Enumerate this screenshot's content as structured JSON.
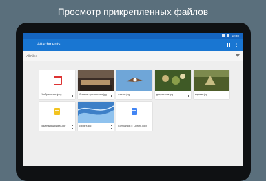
{
  "headline": "Просмотр прикрепленных файлов",
  "statusbar": {
    "time": "12:30"
  },
  "appbar": {
    "back": "←",
    "title": "Attachments"
  },
  "filterbar": {
    "label": "All Files"
  },
  "colors": {
    "appbar": "#1976d2",
    "statusbar": "#1565c0",
    "background": "#5a6f7c"
  },
  "files": [
    {
      "name": "Изображение.jpeg",
      "size": "",
      "thumb": "calendar-icon"
    },
    {
      "name": "Снимок приложения.jpg",
      "size": "",
      "thumb": "photo-stage"
    },
    {
      "name": "знание.jpg",
      "size": "",
      "thumb": "photo-bird"
    },
    {
      "name": "документы.jpg",
      "size": "",
      "thumb": "photo-flowers"
    },
    {
      "name": "каравы.jpg",
      "size": "",
      "thumb": "photo-fields"
    },
    {
      "name": "Лицензия шрифта.pdf",
      "size": "",
      "thumb": "pdf-icon"
    },
    {
      "name": "скрипт.doc",
      "size": "",
      "thumb": "blue-wave"
    },
    {
      "name": "Сompanion 5_Oxford.docx",
      "size": "",
      "thumb": "doc-icon"
    }
  ]
}
